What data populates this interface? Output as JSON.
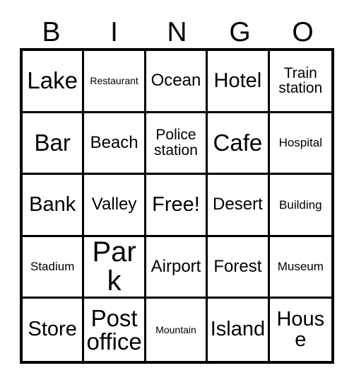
{
  "card": {
    "title_letters": [
      "B",
      "I",
      "N",
      "G",
      "O"
    ],
    "free_space_label": "Free!",
    "colors": {
      "border": "#000000",
      "cell_background": "#ffffff",
      "text": "#000000"
    },
    "rows": [
      [
        {
          "label": "Lake",
          "size": "fs-xxl"
        },
        {
          "label": "Restaurant",
          "size": "fs-xs"
        },
        {
          "label": "Ocean",
          "size": "fs-l"
        },
        {
          "label": "Hotel",
          "size": "fs-xl"
        },
        {
          "label": "Train station",
          "size": "fs-m"
        }
      ],
      [
        {
          "label": "Bar",
          "size": "fs-xxl"
        },
        {
          "label": "Beach",
          "size": "fs-l"
        },
        {
          "label": "Police station",
          "size": "fs-m"
        },
        {
          "label": "Cafe",
          "size": "fs-xxl"
        },
        {
          "label": "Hospital",
          "size": "fs-s"
        }
      ],
      [
        {
          "label": "Bank",
          "size": "fs-xl"
        },
        {
          "label": "Valley",
          "size": "fs-l"
        },
        {
          "label": "Free!",
          "size": "fs-xl"
        },
        {
          "label": "Desert",
          "size": "fs-l"
        },
        {
          "label": "Building",
          "size": "fs-s"
        }
      ],
      [
        {
          "label": "Stadium",
          "size": "fs-s"
        },
        {
          "label": "Park",
          "size": "fs-huge"
        },
        {
          "label": "Airport",
          "size": "fs-l"
        },
        {
          "label": "Forest",
          "size": "fs-l"
        },
        {
          "label": "Museum",
          "size": "fs-s"
        }
      ],
      [
        {
          "label": "Store",
          "size": "fs-xl"
        },
        {
          "label": "Post office",
          "size": "fs-xxl"
        },
        {
          "label": "Mountain",
          "size": "fs-xs"
        },
        {
          "label": "Island",
          "size": "fs-xl"
        },
        {
          "label": "House",
          "size": "fs-xl"
        }
      ]
    ]
  }
}
